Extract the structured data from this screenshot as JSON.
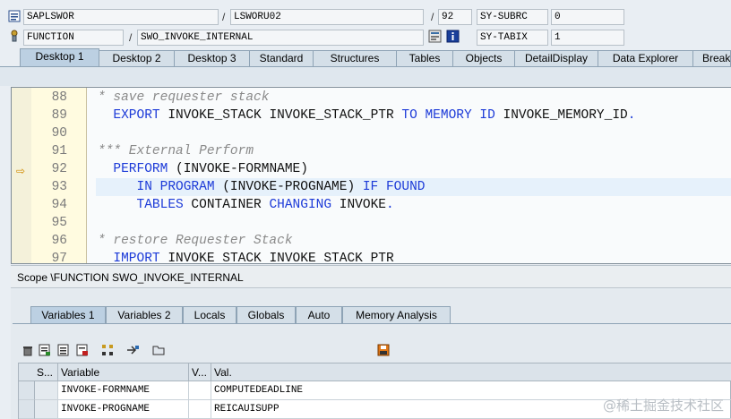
{
  "header": {
    "program": "SAPLSWOR",
    "include": "LSWORU02",
    "line": "92",
    "subrc_label": "SY-SUBRC",
    "subrc_value": "0",
    "type": "FUNCTION",
    "name": "SWO_INVOKE_INTERNAL",
    "tabix_label": "SY-TABIX",
    "tabix_value": "1",
    "sep": "/"
  },
  "desktop_tabs": [
    "Desktop 1",
    "Desktop 2",
    "Desktop 3",
    "Standard",
    "Structures",
    "Tables",
    "Objects",
    "DetailDisplay",
    "Data Explorer",
    "Break"
  ],
  "code_lines": [
    {
      "no": "88",
      "segments": [
        {
          "t": "* save requester stack",
          "c": "cm"
        }
      ]
    },
    {
      "no": "89",
      "segments": [
        {
          "t": "  EXPORT",
          "c": "kw"
        },
        {
          "t": " INVOKE_STACK INVOKE_STACK_PTR ",
          "c": "tx"
        },
        {
          "t": "TO MEMORY ID",
          "c": "kw"
        },
        {
          "t": " INVOKE_MEMORY_ID",
          "c": "tx"
        },
        {
          "t": ".",
          "c": "kw"
        }
      ]
    },
    {
      "no": "90",
      "segments": []
    },
    {
      "no": "91",
      "segments": [
        {
          "t": "*** External Perform",
          "c": "cm"
        }
      ]
    },
    {
      "no": "92",
      "segments": [
        {
          "t": "  PERFORM",
          "c": "kw"
        },
        {
          "t": " (INVOKE-FORMNAME)",
          "c": "tx"
        }
      ]
    },
    {
      "no": "93",
      "segments": [
        {
          "t": "     IN PROGRAM",
          "c": "kw"
        },
        {
          "t": " (INVOKE-PROGNAME) ",
          "c": "tx"
        },
        {
          "t": "IF FOUND",
          "c": "kw"
        }
      ]
    },
    {
      "no": "94",
      "segments": [
        {
          "t": "     TABLES",
          "c": "kw"
        },
        {
          "t": " CONTAINER ",
          "c": "tx"
        },
        {
          "t": "CHANGING",
          "c": "kw"
        },
        {
          "t": " INVOKE",
          "c": "tx"
        },
        {
          "t": ".",
          "c": "kw"
        }
      ]
    },
    {
      "no": "95",
      "segments": []
    },
    {
      "no": "96",
      "segments": [
        {
          "t": "* restore Requester Stack",
          "c": "cm"
        }
      ]
    },
    {
      "no": "97",
      "segments": [
        {
          "t": "  IMPORT",
          "c": "kw"
        },
        {
          "t": " INVOKE STACK INVOKE STACK PTR",
          "c": "tx"
        }
      ]
    }
  ],
  "scope": "Scope \\FUNCTION SWO_INVOKE_INTERNAL",
  "var_tabs": [
    "Variables 1",
    "Variables 2",
    "Locals",
    "Globals",
    "Auto",
    "Memory Analysis"
  ],
  "table": {
    "headers": [
      "S...",
      "Variable",
      "V...",
      "Val."
    ],
    "rows": [
      {
        "variable": "INVOKE-FORMNAME",
        "value": "COMPUTEDEADLINE"
      },
      {
        "variable": "INVOKE-PROGNAME",
        "value": "REICAUISUPP"
      }
    ]
  },
  "watermark": "@稀土掘金技术社区",
  "colors": {
    "keyword": "#1d3bd8",
    "comment": "#8a8a8a",
    "active_tab": "#bcd0e2",
    "tab": "#d4dfe8"
  },
  "icons": [
    "program-icon",
    "function-icon",
    "display-icon",
    "info-icon",
    "delete-icon",
    "save-icon"
  ]
}
